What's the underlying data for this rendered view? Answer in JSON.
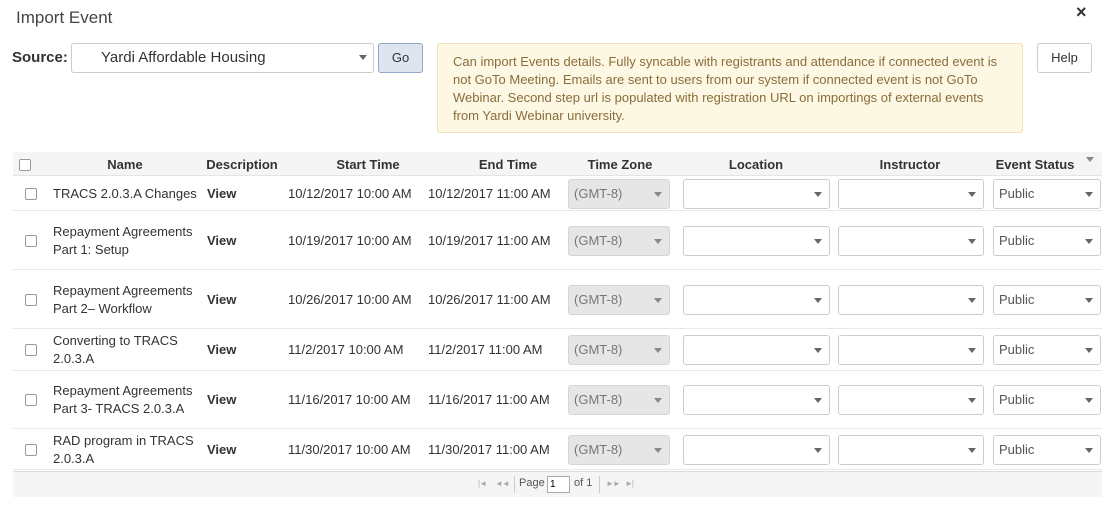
{
  "dialog": {
    "title": "Import Event",
    "close_symbol": "×"
  },
  "source": {
    "label": "Source:",
    "selected": "Yardi Affordable Housing",
    "go_label": "Go"
  },
  "notice": "Can import Events details. Fully syncable with registrants and attendance if connected event is not GoTo Meeting. Emails are sent to users from our system if connected event is not GoTo Webinar. Second step url is populated with registration URL on importings of external events from Yardi Webinar university.",
  "help_label": "Help",
  "table": {
    "headers": {
      "name": "Name",
      "description": "Description",
      "start": "Start Time",
      "end": "End Time",
      "tz": "Time Zone",
      "location": "Location",
      "instructor": "Instructor",
      "status": "Event Status"
    },
    "rows": [
      {
        "name": "TRACS 2.0.3.A Changes",
        "description": "View",
        "start": "10/12/2017 10:00 AM",
        "end": "10/12/2017 11:00 AM",
        "tz": "(GMT-8)",
        "location": "",
        "instructor": "",
        "status": "Public"
      },
      {
        "name": "Repayment Agreements Part 1: Setup",
        "description": "View",
        "start": "10/19/2017 10:00 AM",
        "end": "10/19/2017 11:00 AM",
        "tz": "(GMT-8)",
        "location": "",
        "instructor": "",
        "status": "Public"
      },
      {
        "name": "Repayment Agreements Part 2– Workflow",
        "description": "View",
        "start": "10/26/2017 10:00 AM",
        "end": "10/26/2017 11:00 AM",
        "tz": "(GMT-8)",
        "location": "",
        "instructor": "",
        "status": "Public"
      },
      {
        "name": "Converting to TRACS 2.0.3.A",
        "description": "View",
        "start": "11/2/2017 10:00 AM",
        "end": "11/2/2017 11:00 AM",
        "tz": "(GMT-8)",
        "location": "",
        "instructor": "",
        "status": "Public"
      },
      {
        "name": "Repayment Agreements Part 3- TRACS 2.0.3.A",
        "description": "View",
        "start": "11/16/2017 10:00 AM",
        "end": "11/16/2017 11:00 AM",
        "tz": "(GMT-8)",
        "location": "",
        "instructor": "",
        "status": "Public"
      },
      {
        "name": "RAD program in TRACS 2.0.3.A",
        "description": "View",
        "start": "11/30/2017 10:00 AM",
        "end": "11/30/2017 11:00 AM",
        "tz": "(GMT-8)",
        "location": "",
        "instructor": "",
        "status": "Public"
      }
    ]
  },
  "pager": {
    "page_label": "Page",
    "page_value": "1",
    "of_label": "of 1",
    "first": "|◄",
    "prev": "◄◄",
    "next": "►►",
    "last": "►|"
  }
}
